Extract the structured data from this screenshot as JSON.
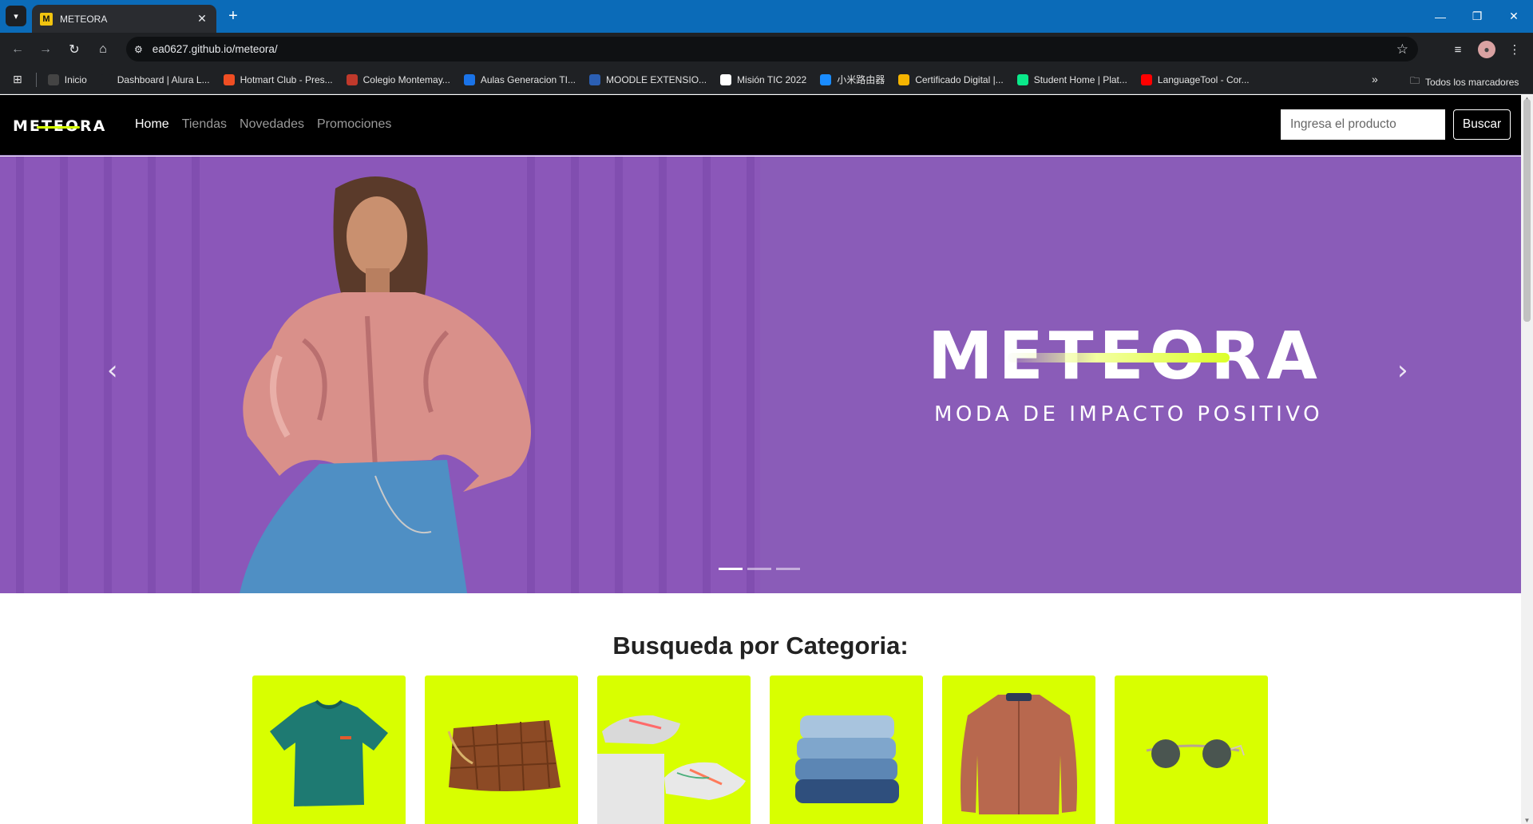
{
  "browser": {
    "tab_title": "METEORA",
    "tab_favicon": "M",
    "url": "ea0627.github.io/meteora/",
    "bookmarks": [
      {
        "label": "Inicio",
        "icon": "home-dark-icon",
        "color": "#444"
      },
      {
        "label": "Dashboard | Alura L...",
        "icon": "alura-a-icon",
        "color": "#1f2124"
      },
      {
        "label": "Hotmart Club - Pres...",
        "icon": "flame-icon",
        "color": "#f04e23"
      },
      {
        "label": "Colegio Montemay...",
        "icon": "shield-icon",
        "color": "#c0392b"
      },
      {
        "label": "Aulas Generacion TI...",
        "icon": "calendar-icon",
        "color": "#1a73e8"
      },
      {
        "label": "MOODLE EXTENSIO...",
        "icon": "triangle-icon",
        "color": "#2b5fb4"
      },
      {
        "label": "Misión TIC 2022",
        "icon": "google-icon",
        "color": "#ffffff"
      },
      {
        "label": "小米路由器",
        "icon": "wifi-icon",
        "color": "#1a8cff"
      },
      {
        "label": "Certificado Digital |...",
        "icon": "certificate-icon",
        "color": "#f5b400"
      },
      {
        "label": "Student Home | Plat...",
        "icon": "platzi-icon",
        "color": "#0ae98a"
      },
      {
        "label": "LanguageTool - Cor...",
        "icon": "youtube-icon",
        "color": "#ff0000"
      }
    ],
    "all_bookmarks": "Todos los marcadores"
  },
  "site": {
    "logo": "METEORA",
    "nav": [
      {
        "label": "Home",
        "active": true
      },
      {
        "label": "Tiendas",
        "active": false
      },
      {
        "label": "Novedades",
        "active": false
      },
      {
        "label": "Promociones",
        "active": false
      }
    ],
    "search_placeholder": "Ingresa el producto",
    "search_button": "Buscar"
  },
  "hero": {
    "brand": "METEORA",
    "tagline": "MODA DE IMPACTO POSITIVO",
    "slides": 3,
    "active_slide": 1
  },
  "categories": {
    "title": "Busqueda por Categoria:",
    "items": [
      {
        "name": "t-shirt",
        "icon": "tshirt-image"
      },
      {
        "name": "bag",
        "icon": "bag-image"
      },
      {
        "name": "sneakers",
        "icon": "sneakers-image"
      },
      {
        "name": "jeans",
        "icon": "jeans-image"
      },
      {
        "name": "jacket",
        "icon": "jacket-image"
      },
      {
        "name": "sunglasses",
        "icon": "sunglasses-image"
      }
    ]
  },
  "colors": {
    "accent": "#d8ff00",
    "hero_bg": "#8a5cb8",
    "chrome_blue": "#0b6bb8"
  }
}
